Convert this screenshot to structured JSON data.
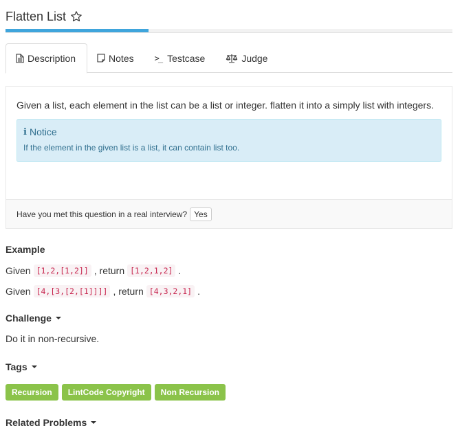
{
  "title": "Flatten List",
  "progress_percent": 32,
  "tabs": [
    {
      "label": "Description",
      "icon": "document-icon"
    },
    {
      "label": "Notes",
      "icon": "note-icon"
    },
    {
      "label": "Testcase",
      "icon": "terminal-icon"
    },
    {
      "label": "Judge",
      "icon": "scales-icon"
    }
  ],
  "description": {
    "text": "Given a list, each element in the list can be a list or integer. flatten it into a simply list with integers.",
    "notice_title": "Notice",
    "notice_text": "If the element in the given list is a list, it can contain list too.",
    "interview_question": "Have you met this question in a real interview?",
    "yes_label": "Yes"
  },
  "example": {
    "heading": "Example",
    "lines": [
      {
        "given": "Given",
        "input": "[1,2,[1,2]]",
        "comma_return": ", return",
        "output": "[1,2,1,2]",
        "end": "."
      },
      {
        "given": "Given",
        "input": "[4,[3,[2,[1]]]]",
        "comma_return": ", return",
        "output": "[4,3,2,1]",
        "end": "."
      }
    ]
  },
  "challenge": {
    "heading": "Challenge",
    "text": "Do it in non-recursive."
  },
  "tags": {
    "heading": "Tags",
    "items": [
      "Recursion",
      "LintCode Copyright",
      "Non Recursion"
    ],
    "color": "#8bc34a"
  },
  "related": {
    "heading": "Related Problems"
  },
  "colors": {
    "progress": "#3fa5dc",
    "notice_bg": "#d9edf7",
    "notice_text": "#31708f",
    "code_text": "#c7254e"
  }
}
